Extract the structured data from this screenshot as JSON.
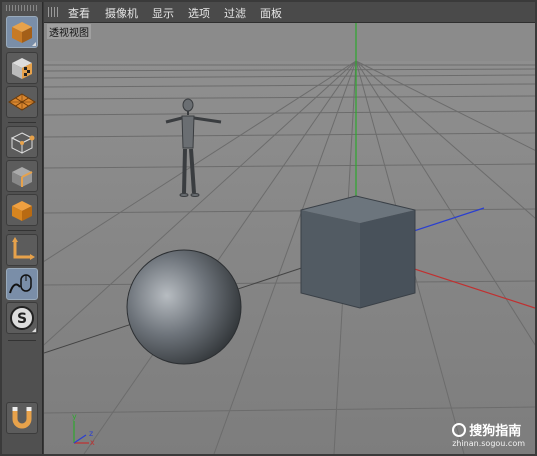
{
  "menu": {
    "items": [
      {
        "label": "查看"
      },
      {
        "label": "摄像机"
      },
      {
        "label": "显示"
      },
      {
        "label": "选项"
      },
      {
        "label": "过滤"
      },
      {
        "label": "面板"
      }
    ]
  },
  "viewport": {
    "label": "透视视图"
  },
  "tools": [
    {
      "icon": "cube-object-icon",
      "active": true
    },
    {
      "icon": "checker-cube-icon",
      "active": false
    },
    {
      "icon": "polygon-grid-icon",
      "active": false
    },
    {
      "icon": "points-mode-icon",
      "active": false
    },
    {
      "icon": "edges-mode-icon",
      "active": false
    },
    {
      "icon": "polygons-mode-icon",
      "active": false
    },
    {
      "icon": "axis-tool-icon",
      "active": false
    },
    {
      "icon": "tweak-mouse-icon",
      "active": true
    },
    {
      "icon": "snap-s-icon",
      "active": false
    },
    {
      "icon": "magnet-icon",
      "active": false
    }
  ],
  "axis_gizmo": {
    "x": "x",
    "y": "y",
    "z": "z"
  },
  "watermark": {
    "name": "搜狗指南",
    "url": "zhinan.sogou.com"
  },
  "colors": {
    "viewport_bg": "#8a8a8a",
    "grid": "#6f6f6f",
    "axis_y": "#2ea82e",
    "axis_x": "#c03030",
    "axis_z": "#2a3fd0",
    "cube": "#5d6770",
    "active_tool": "#7a8ea8"
  }
}
